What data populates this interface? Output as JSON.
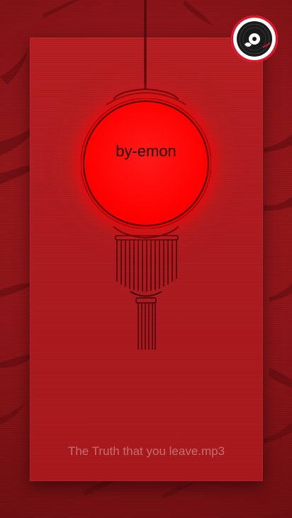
{
  "lantern": {
    "text": "by-emon"
  },
  "song": {
    "title": "The Truth that you leave.mp3"
  },
  "music_button": {
    "icon": "vinyl-record-icon"
  },
  "colors": {
    "background": "#8a1418",
    "card": "#b31d22",
    "lantern": "#ff0000",
    "accent": "#e0102a",
    "song_text": "#c56f6f"
  }
}
